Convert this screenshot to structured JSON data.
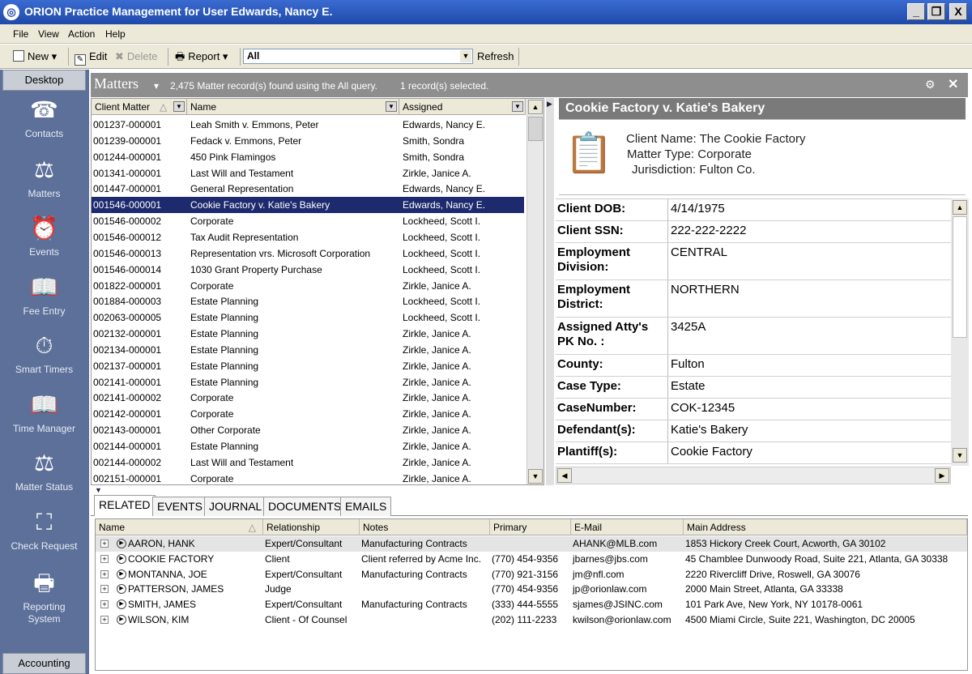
{
  "window": {
    "title": "ORION Practice Management for User Edwards, Nancy E.",
    "minimize": "_",
    "restore": "❐",
    "close": "X"
  },
  "menu": [
    "File",
    "View",
    "Action",
    "Help"
  ],
  "toolbar": {
    "new": "New",
    "edit": "Edit",
    "delete": "Delete",
    "report": "Report",
    "query": "All",
    "refresh": "Refresh"
  },
  "nav": {
    "desktop": "Desktop",
    "accounting": "Accounting",
    "items": [
      "Contacts",
      "Matters",
      "Events",
      "Fee Entry",
      "Smart Timers",
      "Time Manager",
      "Matter Status",
      "Check Request",
      "Reporting\nSystem"
    ]
  },
  "matters": {
    "title": "Matters",
    "found": "2,475 Matter record(s) found using the All query.",
    "selected": "1 record(s) selected.",
    "columns": [
      "Client Matter",
      "Name",
      "Assigned"
    ],
    "rows": [
      [
        "001237-000001",
        "Leah Smith v. Emmons, Peter",
        "Edwards, Nancy E."
      ],
      [
        "001239-000001",
        "Fedack v. Emmons, Peter",
        "Smith, Sondra"
      ],
      [
        "001244-000001",
        "450 Pink Flamingos",
        "Smith, Sondra"
      ],
      [
        "001341-000001",
        "Last Will and Testament",
        "Zirkle, Janice A."
      ],
      [
        "001447-000001",
        "General Representation",
        "Edwards, Nancy E."
      ],
      [
        "001546-000001",
        "Cookie Factory v. Katie's Bakery",
        "Edwards, Nancy E."
      ],
      [
        "001546-000002",
        "Corporate",
        "Lockheed, Scott I."
      ],
      [
        "001546-000012",
        "Tax Audit Representation",
        "Lockheed, Scott I."
      ],
      [
        "001546-000013",
        "Representation vrs. Microsoft Corporation",
        "Lockheed, Scott I."
      ],
      [
        "001546-000014",
        "1030 Grant Property Purchase",
        "Lockheed, Scott I."
      ],
      [
        "001822-000001",
        "Corporate",
        "Zirkle, Janice A."
      ],
      [
        "001884-000003",
        "Estate Planning",
        "Lockheed, Scott I."
      ],
      [
        "002063-000005",
        "Estate Planning",
        "Lockheed, Scott I."
      ],
      [
        "002132-000001",
        "Estate Planning",
        "Zirkle, Janice A."
      ],
      [
        "002134-000001",
        "Estate Planning",
        "Zirkle, Janice A."
      ],
      [
        "002137-000001",
        "Estate Planning",
        "Zirkle, Janice A."
      ],
      [
        "002141-000001",
        "Estate Planning",
        "Zirkle, Janice A."
      ],
      [
        "002141-000002",
        "Corporate",
        "Zirkle, Janice A."
      ],
      [
        "002142-000001",
        "Corporate",
        "Zirkle, Janice A."
      ],
      [
        "002143-000001",
        "Other Corporate",
        "Zirkle, Janice A."
      ],
      [
        "002144-000001",
        "Estate Planning",
        "Zirkle, Janice A."
      ],
      [
        "002144-000002",
        "Last Will and Testament",
        "Zirkle, Janice A."
      ],
      [
        "002151-000001",
        "Corporate",
        "Zirkle, Janice A."
      ]
    ],
    "selected_index": 5
  },
  "detail": {
    "title": "Cookie Factory v. Katie's Bakery",
    "client_name": "Client Name:  The Cookie Factory",
    "matter_type": "Matter Type:  Corporate",
    "jurisdiction": "Jurisdiction:  Fulton Co.",
    "fields": [
      {
        "k": "Client DOB:",
        "v": "4/14/1975"
      },
      {
        "k": "Client SSN:",
        "v": "222-222-2222"
      },
      {
        "k": "Employment Division:",
        "v": "CENTRAL"
      },
      {
        "k": "Employment District:",
        "v": "NORTHERN"
      },
      {
        "k": "Assigned Atty's PK No. :",
        "v": "3425A"
      },
      {
        "k": "County:",
        "v": "Fulton"
      },
      {
        "k": "Case Type:",
        "v": "Estate"
      },
      {
        "k": "CaseNumber:",
        "v": "COK-12345"
      },
      {
        "k": "Defendant(s):",
        "v": "Katie's Bakery"
      },
      {
        "k": "Plantiff(s):",
        "v": "Cookie Factory"
      }
    ]
  },
  "tabs": [
    "RELATED",
    "EVENTS",
    "JOURNAL",
    "DOCUMENTS",
    "EMAILS"
  ],
  "related": {
    "columns": [
      "Name",
      "Relationship",
      "Notes",
      "Primary",
      "E-Mail",
      "Main Address"
    ],
    "rows": [
      [
        "AARON, HANK",
        "Expert/Consultant",
        "Manufacturing Contracts",
        "",
        "AHANK@MLB.com",
        "1853 Hickory Creek Court, Acworth, GA 30102"
      ],
      [
        "COOKIE FACTORY",
        "Client",
        "Client referred by Acme Inc.",
        "(770) 454-9356",
        "jbarnes@jbs.com",
        "45 Chamblee Dunwoody Road, Suite 221, Atlanta, GA 30338"
      ],
      [
        "MONTANNA, JOE",
        "Expert/Consultant",
        "Manufacturing Contracts",
        "(770) 921-3156",
        "jm@nfl.com",
        "2220 Rivercliff Drive, Roswell, GA 30076"
      ],
      [
        "PATTERSON, JAMES",
        "Judge",
        "",
        "(770) 454-9356",
        "jp@orionlaw.com",
        "2000 Main Street, Atlanta, GA 33338"
      ],
      [
        "SMITH, JAMES",
        "Expert/Consultant",
        "Manufacturing Contracts",
        "(333) 444-5555",
        "sjames@JSINC.com",
        "101 Park Ave, New York, NY 10178-0061"
      ],
      [
        "WILSON, KIM",
        "Client - Of Counsel",
        "",
        "(202) 111-2233",
        "kwilson@orionlaw.com",
        "4500 Miami Circle, Suite 221, Washington, DC 20005"
      ]
    ]
  }
}
